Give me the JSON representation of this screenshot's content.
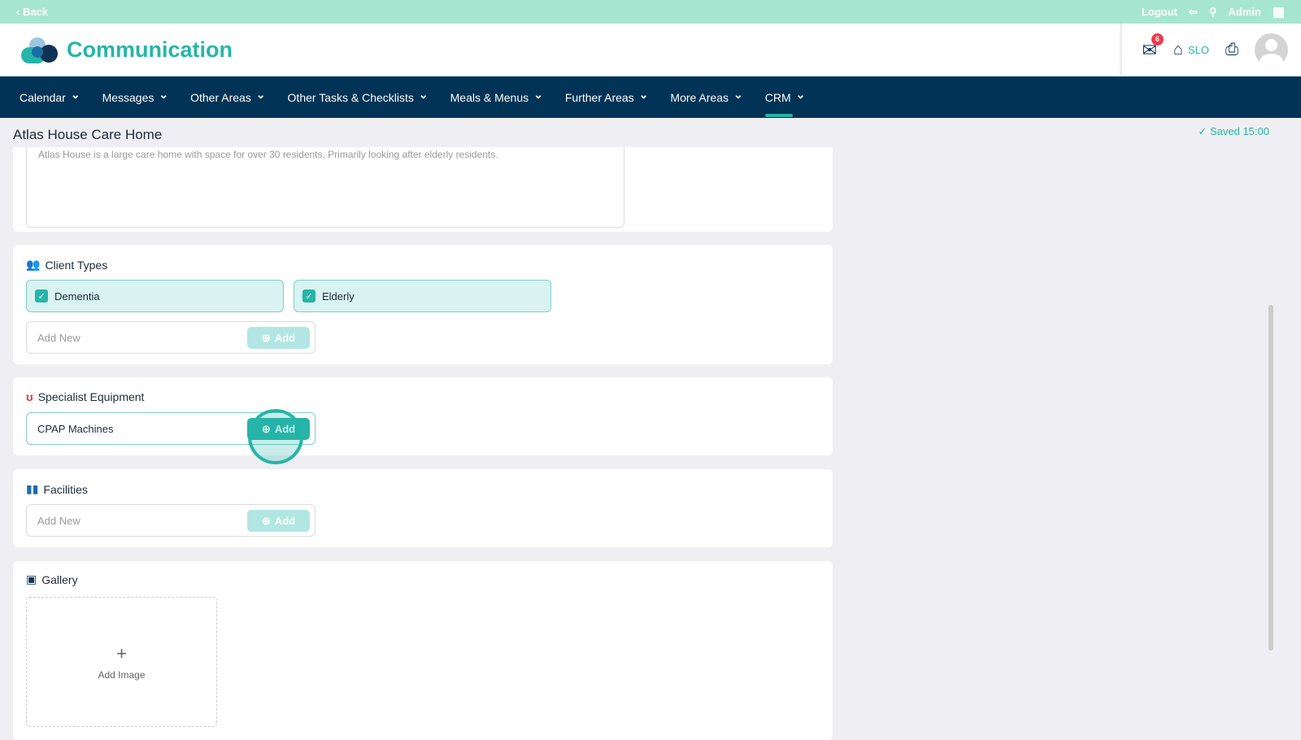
{
  "topbar": {
    "back": "‹ Back",
    "logout": "Logout",
    "admin": "Admin"
  },
  "header": {
    "app_title": "Communication",
    "mail_count": "6",
    "home_label": "SLO"
  },
  "nav": [
    "Calendar",
    "Messages",
    "Other Areas",
    "Other Tasks & Checklists",
    "Meals & Menus",
    "Further Areas",
    "More Areas",
    "CRM"
  ],
  "page": {
    "title": "Atlas House Care Home",
    "saved": "Saved 15:00"
  },
  "description": "Atlas House is a large care home with space for over 30 residents. Primarily looking after elderly residents.",
  "client_types": {
    "title": "Client Types",
    "items": [
      "Dementia",
      "Elderly"
    ],
    "placeholder": "Add New",
    "add": "Add"
  },
  "equipment": {
    "title": "Specialist Equipment",
    "value": "CPAP Machines",
    "add": "Add"
  },
  "facilities": {
    "title": "Facilities",
    "placeholder": "Add New",
    "add": "Add"
  },
  "gallery": {
    "title": "Gallery",
    "plus": "+",
    "add_image": "Add Image"
  },
  "colors": {
    "accent": "#26b5a8",
    "nav": "#003355",
    "topbar": "#a6e6d0"
  }
}
